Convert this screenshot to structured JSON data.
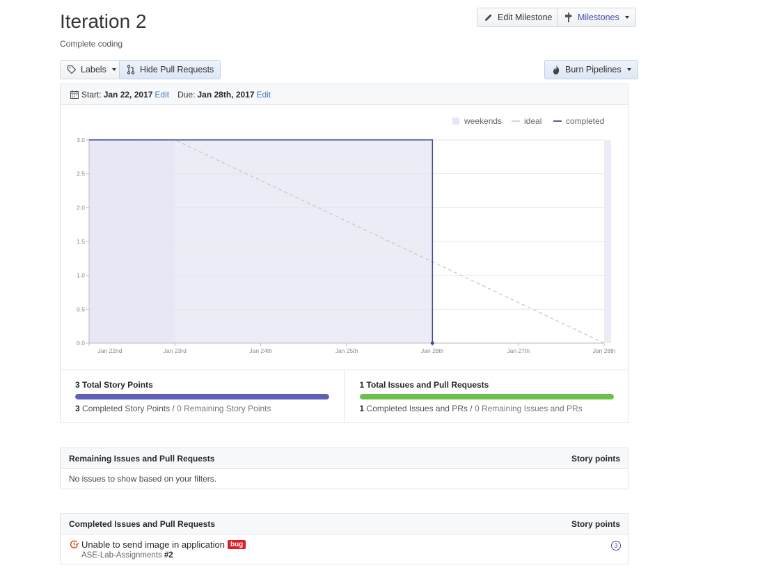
{
  "header": {
    "title": "Iteration 2",
    "subtitle": "Complete coding",
    "edit_milestone": "Edit Milestone",
    "milestones": "Milestones"
  },
  "toolbar": {
    "labels": "Labels",
    "hide_prs": "Hide Pull Requests",
    "burn_pipelines": "Burn Pipelines"
  },
  "dates": {
    "start_label": "Start:",
    "start_value": "Jan 22, 2017",
    "start_edit": "Edit",
    "due_label": "Due:",
    "due_value": "Jan 28th, 2017",
    "due_edit": "Edit"
  },
  "chart_data": {
    "type": "line",
    "x": [
      "Jan 22nd",
      "Jan 23rd",
      "Jan 24th",
      "Jan 25th",
      "Jan 26th",
      "Jan 27th",
      "Jan 28th"
    ],
    "ylim": [
      0,
      3
    ],
    "yticks": [
      "0.0",
      "0.5",
      "1.0",
      "1.5",
      "2.0",
      "2.5",
      "3.0"
    ],
    "legend": [
      "weekends",
      "ideal",
      "completed"
    ],
    "legend_position": "top-right",
    "grid": true,
    "weekends": [
      [
        0,
        1
      ],
      [
        6,
        6.08
      ]
    ],
    "ideal": [
      [
        0,
        3
      ],
      [
        1,
        3
      ],
      [
        6,
        0
      ]
    ],
    "completed": [
      [
        0,
        3
      ],
      [
        4,
        3
      ],
      [
        4,
        0
      ]
    ],
    "colors": {
      "weekends": "#e6e6f4",
      "ideal": "#c8c8c8",
      "completed": "#3f4aa0",
      "area": "#ececf6"
    }
  },
  "stats": {
    "story_title": "3 Total Story Points",
    "story_completed_num": "3",
    "story_completed_text": " Completed Story Points / ",
    "story_remaining": "0 Remaining Story Points",
    "story_progress": 1.0,
    "story_color": "#5f61b8",
    "issues_title": "1 Total Issues and Pull Requests",
    "issues_completed_num": "1",
    "issues_completed_text": " Completed Issues and PRs / ",
    "issues_remaining": "0 Remaining Issues and PRs",
    "issues_progress": 1.0,
    "issues_color": "#6cc04a"
  },
  "remaining": {
    "title": "Remaining Issues and Pull Requests",
    "points_header": "Story points",
    "empty": "No issues to show based on your filters."
  },
  "completed": {
    "title": "Completed Issues and Pull Requests",
    "points_header": "Story points",
    "issues": [
      {
        "title": "Unable to send image in application",
        "label": "bug",
        "repo": "ASE-Lab-Assignments",
        "number": "#2",
        "points": "3"
      }
    ]
  }
}
